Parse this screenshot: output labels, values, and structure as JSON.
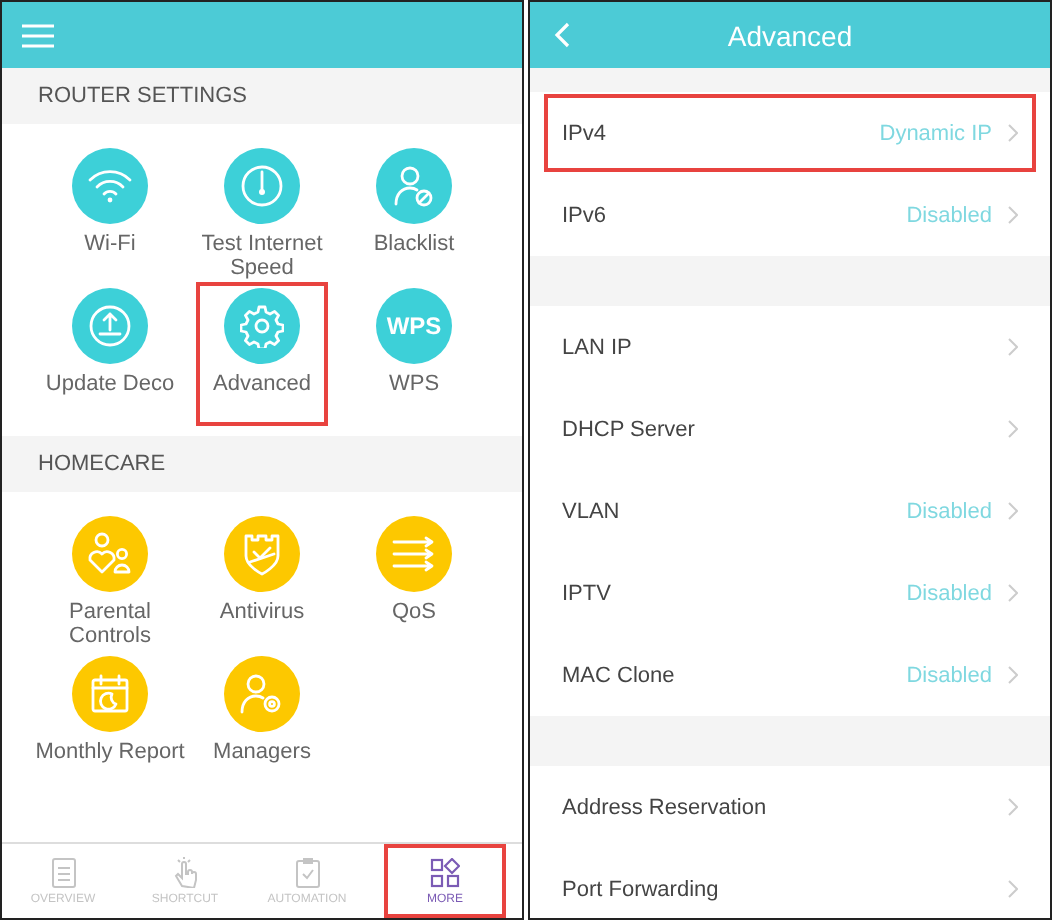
{
  "left_screen": {
    "sections": [
      {
        "title": "ROUTER SETTINGS",
        "kind": "router",
        "tiles": [
          {
            "label": "Wi-Fi",
            "highlighted": false
          },
          {
            "label": "Test Internet Speed",
            "highlighted": false
          },
          {
            "label": "Blacklist",
            "highlighted": false
          },
          {
            "label": "Update Deco",
            "highlighted": false
          },
          {
            "label": "Advanced",
            "highlighted": true
          },
          {
            "label": "WPS",
            "badge": "WPS",
            "highlighted": false
          }
        ]
      },
      {
        "title": "HOMECARE",
        "kind": "homecare",
        "tiles": [
          {
            "label": "Parental Controls",
            "highlighted": false
          },
          {
            "label": "Antivirus",
            "highlighted": false
          },
          {
            "label": "QoS",
            "highlighted": false
          },
          {
            "label": "Monthly Report",
            "highlighted": false
          },
          {
            "label": "Managers",
            "highlighted": false
          }
        ]
      }
    ],
    "tabs": [
      {
        "label": "OVERVIEW",
        "selected": false,
        "highlighted": false
      },
      {
        "label": "SHORTCUT",
        "selected": false,
        "highlighted": false
      },
      {
        "label": "AUTOMATION",
        "selected": false,
        "highlighted": false
      },
      {
        "label": "MORE",
        "selected": true,
        "highlighted": true
      }
    ]
  },
  "right_screen": {
    "title": "Advanced",
    "groups": [
      [
        {
          "label": "IPv4",
          "value": "Dynamic IP",
          "highlighted": true
        },
        {
          "label": "IPv6",
          "value": "Disabled",
          "highlighted": false
        }
      ],
      [
        {
          "label": "LAN IP",
          "highlighted": false
        },
        {
          "label": "DHCP Server",
          "highlighted": false
        },
        {
          "label": "VLAN",
          "value": "Disabled",
          "highlighted": false
        },
        {
          "label": "IPTV",
          "value": "Disabled",
          "highlighted": false
        },
        {
          "label": "MAC Clone",
          "value": "Disabled",
          "highlighted": false
        }
      ],
      [
        {
          "label": "Address Reservation",
          "highlighted": false
        },
        {
          "label": "Port Forwarding",
          "highlighted": false
        }
      ]
    ]
  }
}
